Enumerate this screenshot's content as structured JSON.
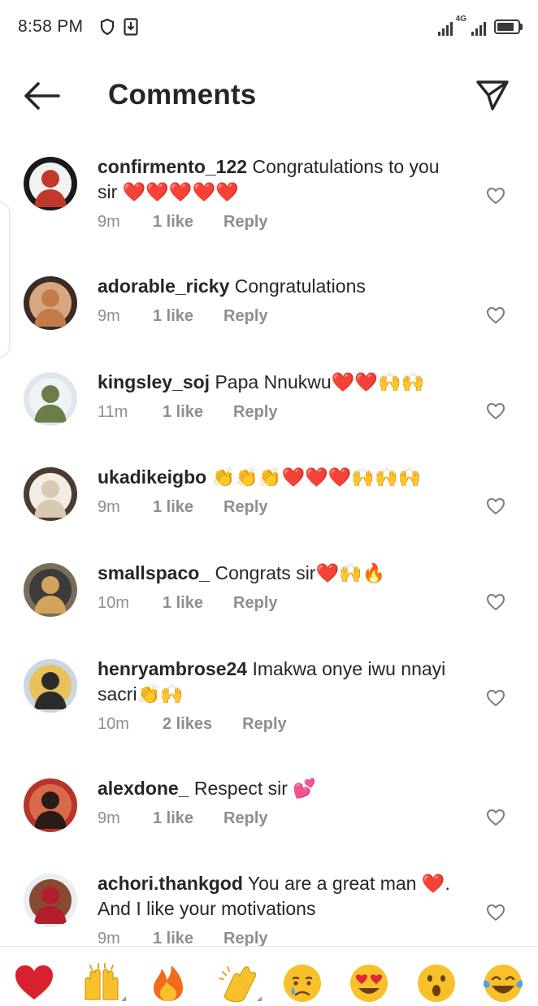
{
  "status_bar": {
    "time": "8:58 PM",
    "network": "4G",
    "battery_level": 0.85
  },
  "header": {
    "title": "Comments",
    "back_icon": "arrow-left-icon",
    "share_icon": "paper-plane-icon"
  },
  "comments": [
    {
      "username": "confirmento_122",
      "text": "Congratulations to you sir ❤️❤️❤️❤️❤️",
      "time": "9m",
      "likes": "1 like",
      "reply": "Reply",
      "avatar": "profile-photo"
    },
    {
      "username": "adorable_ricky",
      "text": "Congratulations",
      "time": "9m",
      "likes": "1 like",
      "reply": "Reply",
      "avatar": "profile-photo"
    },
    {
      "username": "kingsley_soj",
      "text": "Papa Nnukwu❤️❤️🙌🙌",
      "time": "11m",
      "likes": "1 like",
      "reply": "Reply",
      "avatar": "profile-photo"
    },
    {
      "username": "ukadikeigbo",
      "text": "👏👏👏❤️❤️❤️🙌🙌🙌",
      "time": "9m",
      "likes": "1 like",
      "reply": "Reply",
      "avatar": "profile-photo"
    },
    {
      "username": "smallspaco_",
      "text": "Congrats sir❤️🙌🔥",
      "time": "10m",
      "likes": "1 like",
      "reply": "Reply",
      "avatar": "profile-photo"
    },
    {
      "username": "henryambrose24",
      "text": "Imakwa onye iwu nnayi sacri👏🙌",
      "time": "10m",
      "likes": "2 likes",
      "reply": "Reply",
      "avatar": "profile-photo"
    },
    {
      "username": "alexdone_",
      "text": "Respect sir 💕",
      "time": "9m",
      "likes": "1 like",
      "reply": "Reply",
      "avatar": "profile-photo"
    },
    {
      "username": "achori.thankgod",
      "text": "You are a great man ❤️. And I like your motivations",
      "time": "9m",
      "likes": "1 like",
      "reply": "Reply",
      "avatar": "profile-photo"
    }
  ],
  "emoji_bar": [
    {
      "glyph": "❤️",
      "name": "red-heart"
    },
    {
      "glyph": "🙌",
      "name": "raising-hands"
    },
    {
      "glyph": "🔥",
      "name": "fire"
    },
    {
      "glyph": "👏",
      "name": "clapping-hands"
    },
    {
      "glyph": "😢",
      "name": "crying-face"
    },
    {
      "glyph": "😍",
      "name": "heart-eyes"
    },
    {
      "glyph": "😮",
      "name": "open-mouth"
    },
    {
      "glyph": "😂",
      "name": "tears-of-joy"
    }
  ],
  "colors": {
    "text": "#262626",
    "meta": "#8e8e8e",
    "heart_red": "#e0202e",
    "emoji_yellow": "#f8c12b",
    "divider": "#e3e3e3"
  }
}
